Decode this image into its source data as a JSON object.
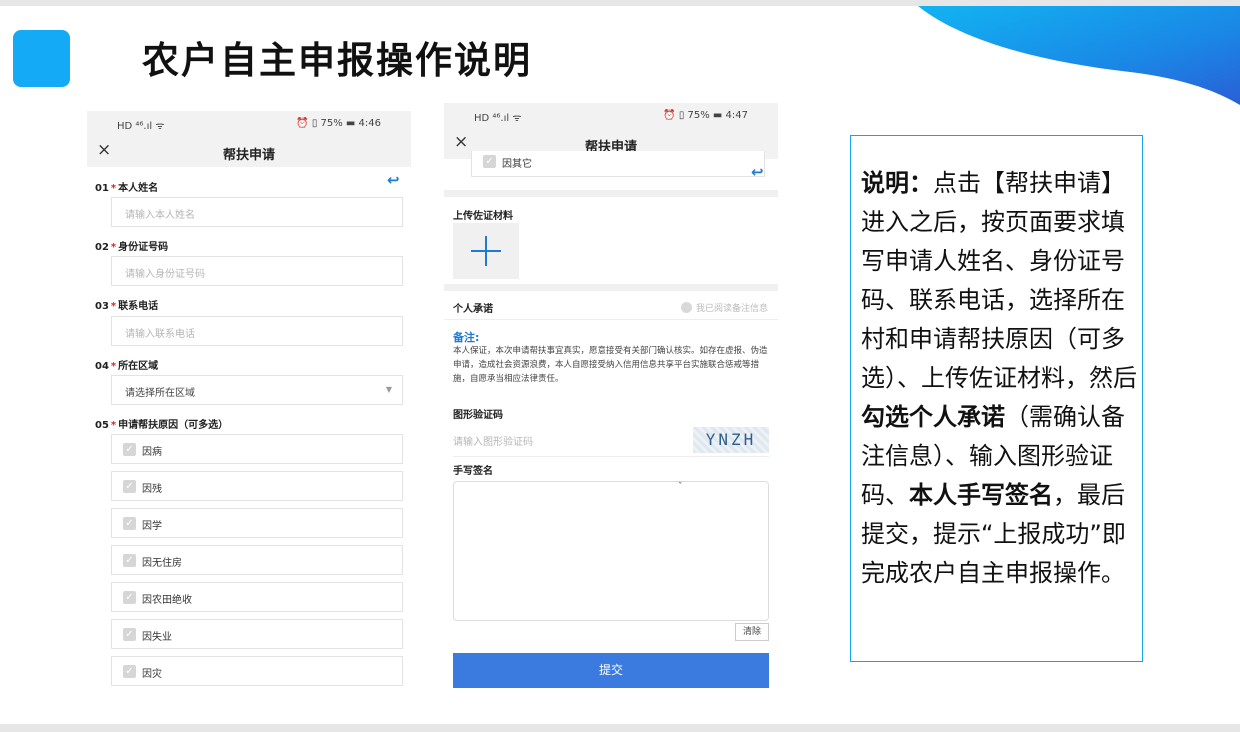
{
  "slide": {
    "title": "农户自主申报操作说明",
    "colors": {
      "accent": "#14aaf5",
      "brand_blue": "#1f7ad6",
      "submit_blue": "#3b7be0",
      "required": "#e02020"
    }
  },
  "phone1": {
    "status_left": "HD ⁴⁶.ıl ᯤ",
    "status_right": "⏰ ▯ 75% ▬ 4:46",
    "close_icon": "×",
    "nav_title": "帮扶申请",
    "back_icon": "↩",
    "fields": [
      {
        "num": "01",
        "label": "本人姓名",
        "placeholder": "请输入本人姓名"
      },
      {
        "num": "02",
        "label": "身份证号码",
        "placeholder": "请输入身份证号码"
      },
      {
        "num": "03",
        "label": "联系电话",
        "placeholder": "请输入联系电话"
      },
      {
        "num": "04",
        "label": "所在区域",
        "value": "请选择所在区域"
      },
      {
        "num": "05",
        "label": "申请帮扶原因（可多选）"
      }
    ],
    "reasons": [
      "因病",
      "因残",
      "因学",
      "因无住房",
      "因农田绝收",
      "因失业",
      "因灾"
    ]
  },
  "phone2": {
    "status_left": "HD ⁴⁶.ıl ᯤ",
    "status_right": "⏰ ▯ 75% ▬ 4:47",
    "close_icon": "×",
    "nav_title": "帮扶申请",
    "partial_reason": "因其它",
    "upload_label": "上传佐证材料",
    "commitment_label": "个人承诺",
    "consent_text": "我已阅读备注信息",
    "note_title": "备注:",
    "note_body": "本人保证，本次申请帮扶事宜真实，愿意接受有关部门确认核实。如存在虚报、伪造申请，造成社会资源浪费，本人自愿接受纳入信用信息共享平台实施联合惩戒等措施，自愿承当相应法律责任。",
    "captcha_label": "图形验证码",
    "captcha_placeholder": "请输入图形验证码",
    "captcha_text": "YNZH",
    "signature_label": "手写签名",
    "signature_mark": "ˇ",
    "clear_label": "清除",
    "submit_label": "提交"
  },
  "explanation": {
    "lead": "说明：",
    "p1": "点击【帮扶申请】进入之后，按页面要求填写申请人姓名、身份证号码、联系电话，选择所在村和申请帮扶原因（可多选）、上传佐证材料，然后",
    "b1": "勾选个人承诺",
    "p2": "（需确认备注信息）、输入图形验证码、",
    "b2": "本人手写签名",
    "p3": "，最后提交，提示“上报成功”即完成农户自主申报操作。"
  }
}
